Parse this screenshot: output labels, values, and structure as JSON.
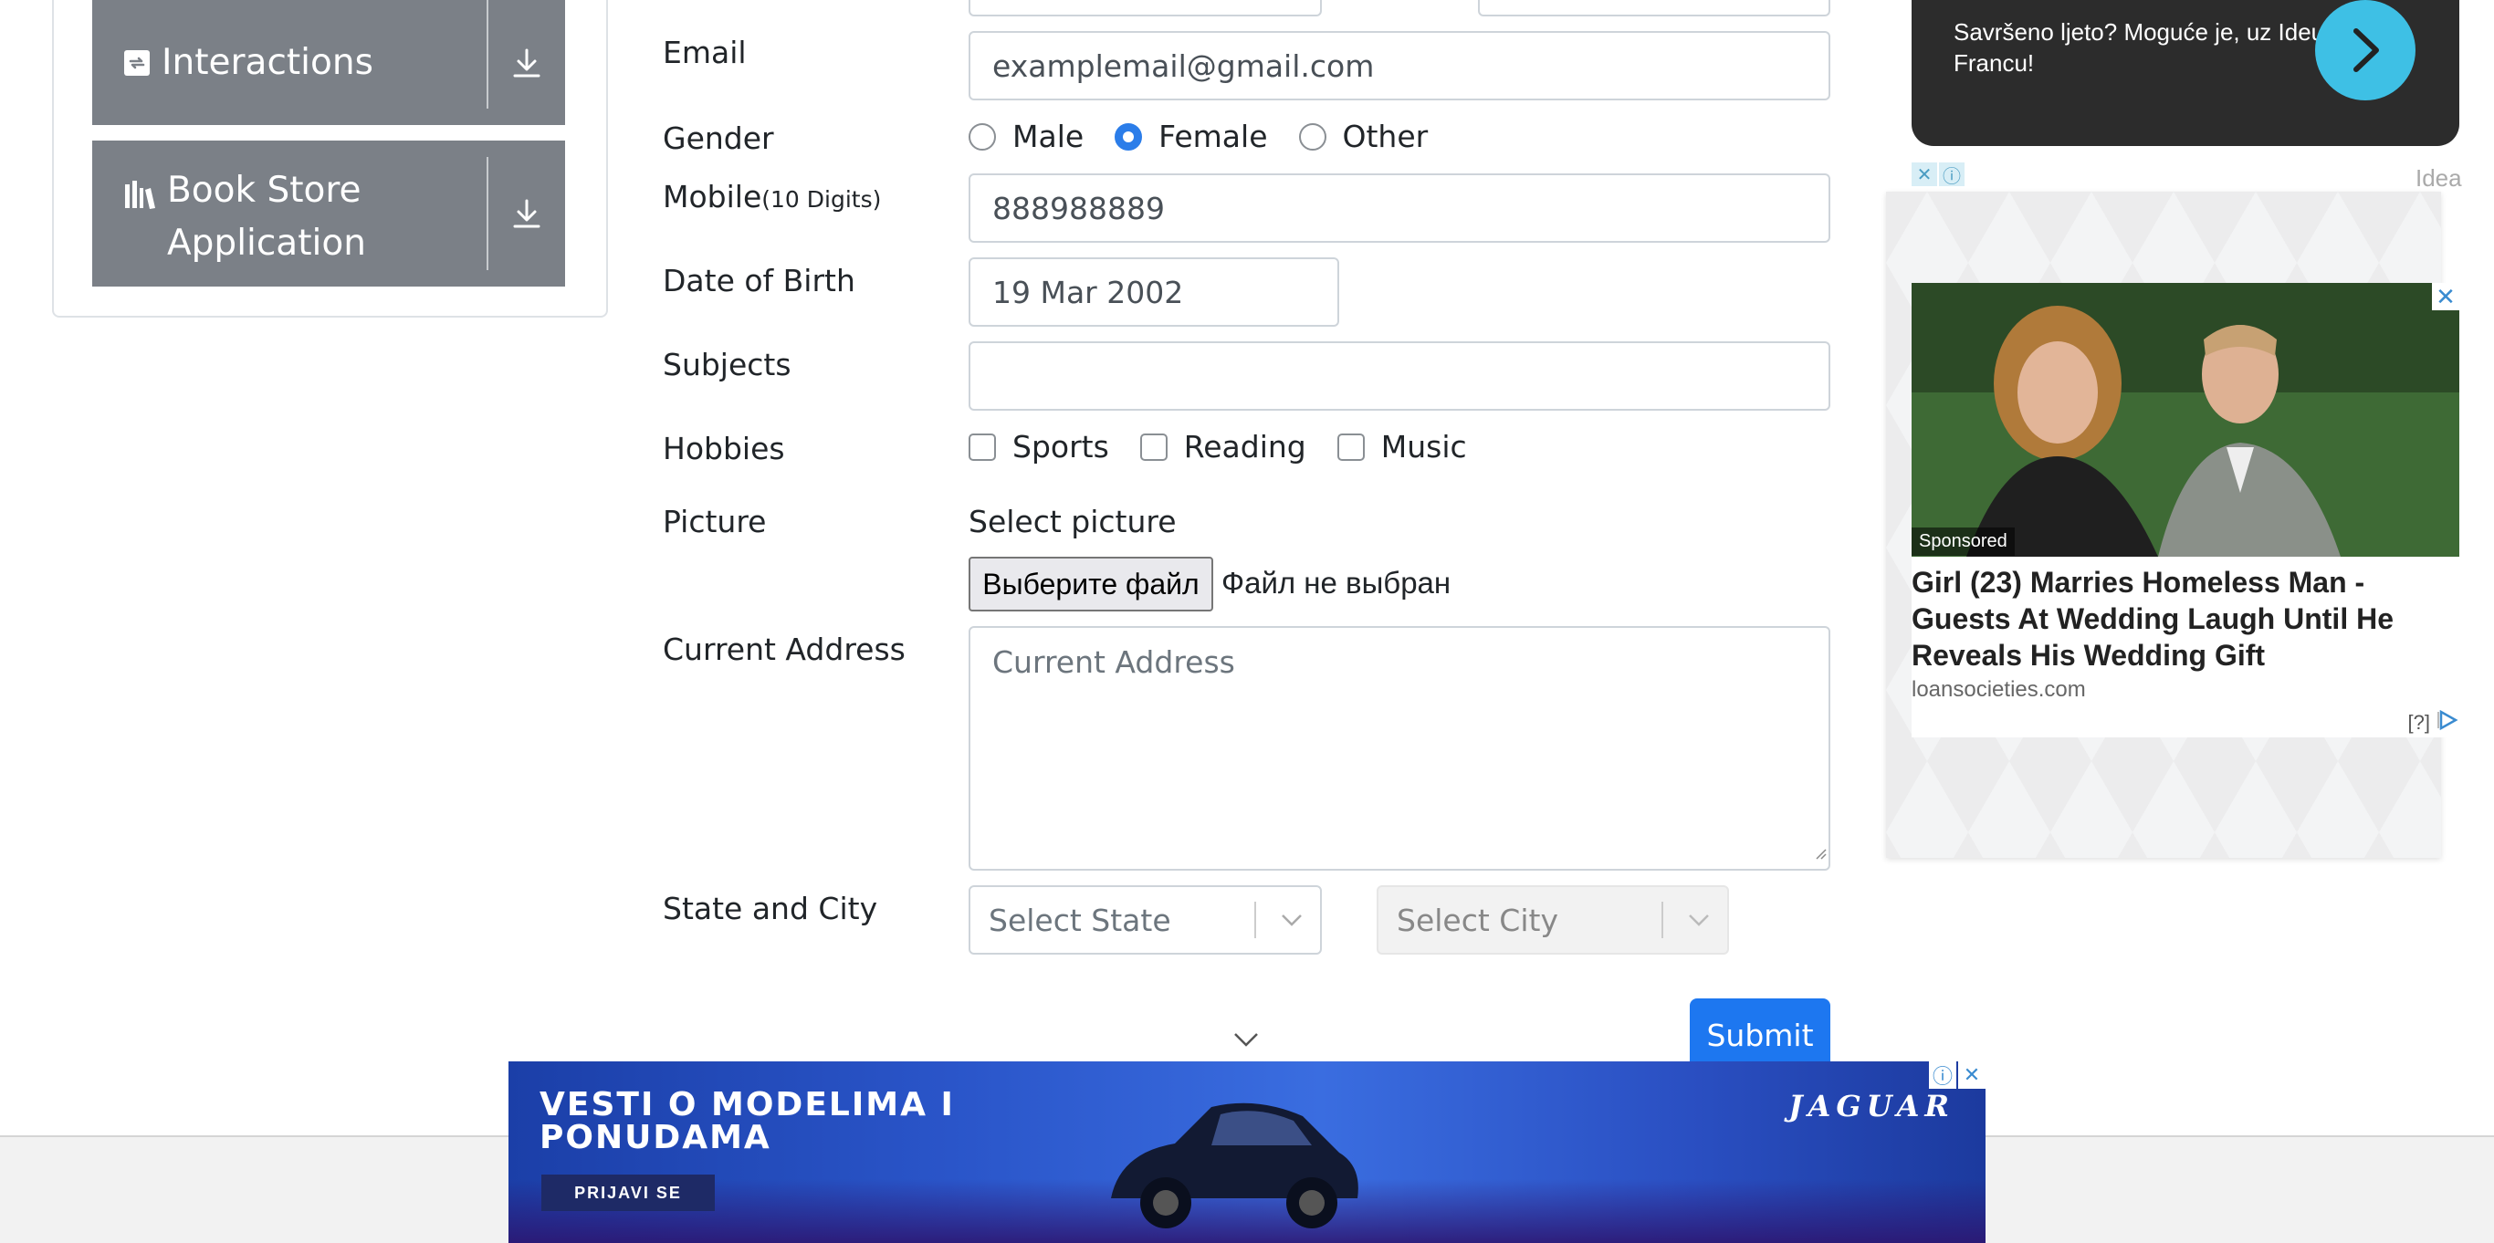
{
  "sidebar": {
    "items": [
      {
        "label": "Interactions",
        "icon": "interactions-icon"
      },
      {
        "label_line1": "Book Store",
        "label_line2": "Application",
        "icon": "books-icon"
      }
    ],
    "colors": {
      "item_bg": "#7b8087"
    }
  },
  "form": {
    "email": {
      "label": "Email",
      "value": "examplemail@gmail.com"
    },
    "gender": {
      "label": "Gender",
      "options": [
        "Male",
        "Female",
        "Other"
      ],
      "selected": "Female"
    },
    "mobile": {
      "label": "Mobile",
      "hint": "(10 Digits)",
      "value": "888988889"
    },
    "dob": {
      "label": "Date of Birth",
      "value": "19 Mar 2002"
    },
    "subjects": {
      "label": "Subjects",
      "value": ""
    },
    "hobbies": {
      "label": "Hobbies",
      "options": [
        "Sports",
        "Reading",
        "Music"
      ]
    },
    "picture": {
      "label": "Picture",
      "select_text": "Select picture",
      "button": "Выберите файл",
      "status": "Файл не выбран"
    },
    "address": {
      "label": "Current Address",
      "placeholder": "Current Address"
    },
    "state_city": {
      "label": "State and City",
      "state_placeholder": "Select State",
      "city_placeholder": "Select City"
    },
    "submit": "Submit",
    "accent": "#1d77f0"
  },
  "ads": {
    "promo": {
      "text": "Savršeno ljeto? Moguće je, uz Ideu i Francu!",
      "brand": "Idea",
      "arrow_color": "#3ec0e5"
    },
    "sponsored": {
      "tag": "Sponsored",
      "headline": "Girl (23) Marries Homeless Man - Guests At Wedding Laugh Until He Reveals His Wedding Gift",
      "domain": "loansocieties.com",
      "info": "[?]"
    },
    "banner": {
      "title_line1": "VESTI O MODELIMA I",
      "title_line2": "PONUDAMA",
      "cta": "PRIJAVI SE",
      "brand": "JAGUAR"
    }
  }
}
